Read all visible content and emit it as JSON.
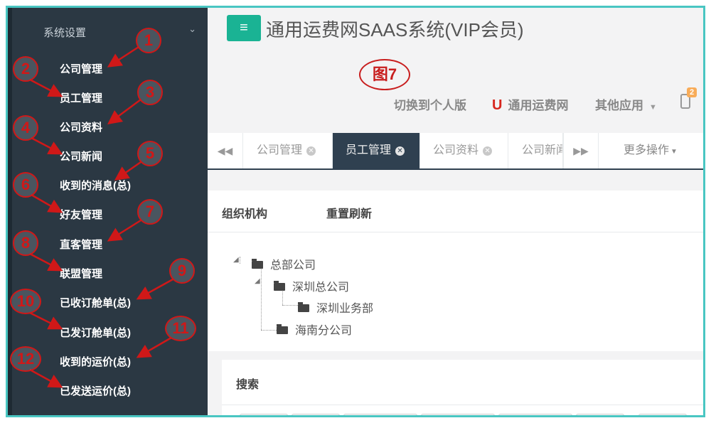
{
  "sidebar": {
    "header": "系统设置",
    "items": [
      {
        "label": "公司管理",
        "num": "1"
      },
      {
        "label": "员工管理",
        "num": "2"
      },
      {
        "label": "公司资料",
        "num": "3"
      },
      {
        "label": "公司新闻",
        "num": "4"
      },
      {
        "label": "收到的消息(总)",
        "num": "5"
      },
      {
        "label": "好友管理",
        "num": "6"
      },
      {
        "label": "直客管理",
        "num": "7"
      },
      {
        "label": "联盟管理",
        "num": "8"
      },
      {
        "label": "已收订舱单(总)",
        "num": "9"
      },
      {
        "label": "已发订舱单(总)",
        "num": "10"
      },
      {
        "label": "收到的运价(总)",
        "num": "11"
      },
      {
        "label": "已发送运价(总)",
        "num": "12"
      }
    ]
  },
  "header": {
    "menu_icon": "≡",
    "title": "通用运费网SAAS系统(VIP会员)",
    "figure_label": "图7",
    "switch_personal": "切换到个人版",
    "logo_letter": "U",
    "brand": "通用运费网",
    "other_apps": "其他应用",
    "notification_count": "2"
  },
  "tabs": {
    "items": [
      {
        "label": "公司管理"
      },
      {
        "label": "员工管理"
      },
      {
        "label": "公司资料"
      },
      {
        "label": "公司新闻"
      }
    ],
    "more": "更多操作"
  },
  "org": {
    "org_label": "组织机构",
    "refresh_label": "重置刷新",
    "tree": [
      "总部公司",
      "深圳总公司",
      "深圳业务部",
      "海南分公司"
    ]
  },
  "search": {
    "title": "搜索"
  },
  "colors": {
    "sidebar_bg": "#2b3843",
    "accent": "#1ab394",
    "tab_active": "#2f4050",
    "annotation": "#d01818",
    "badge": "#f8ac59"
  }
}
